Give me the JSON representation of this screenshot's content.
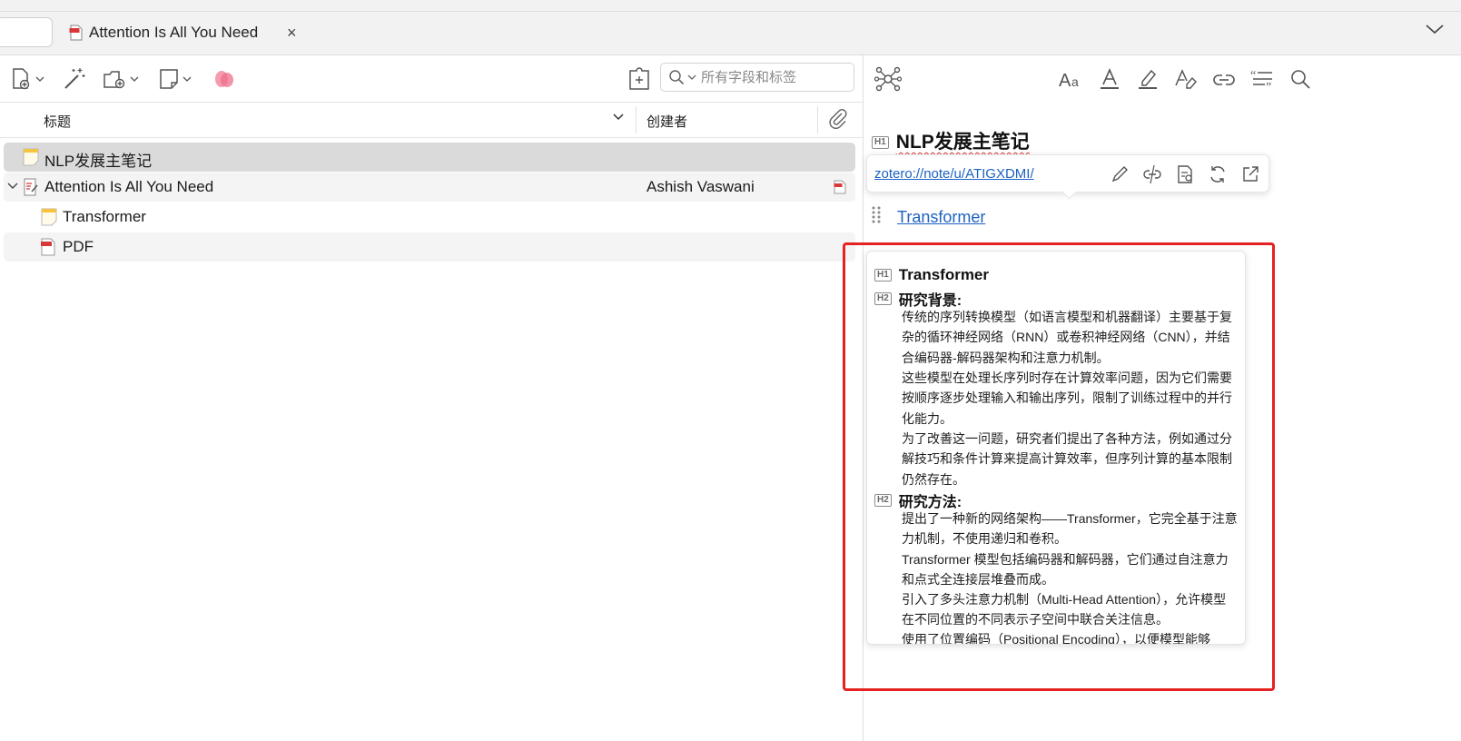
{
  "tabs": {
    "active_tab_title": "Attention Is All You Need",
    "close_symbol": "×"
  },
  "toolbar": {
    "search_placeholder": "所有字段和标签"
  },
  "items_table": {
    "columns": {
      "title": "标题",
      "creator": "创建者"
    },
    "rows": [
      {
        "title": "NLP发展主笔记",
        "creator": "",
        "icon": "note-icon",
        "selected": true
      },
      {
        "title": "Attention Is All You Need",
        "creator": "Ashish Vaswani",
        "icon": "journal-article-icon",
        "expanded": true,
        "has_pdf": true
      },
      {
        "title": "Transformer",
        "creator": "",
        "icon": "note-icon",
        "child": true
      },
      {
        "title": "PDF",
        "creator": "",
        "icon": "pdf-icon",
        "child": true
      }
    ]
  },
  "note_editor": {
    "heading_badge": "H1",
    "h2_badge": "H2",
    "title": "NLP发展主笔记",
    "link_popup": {
      "url": "zotero://note/u/ATIGXDMI/"
    },
    "link_text": "Transformer",
    "preview": {
      "title": "Transformer",
      "section1_heading": "研究背景:",
      "section1_paragraphs": [
        "传统的序列转换模型（如语言模型和机器翻译）主要基于复杂的循环神经网络（RNN）或卷积神经网络（CNN），并结合编码器-解码器架构和注意力机制。",
        "这些模型在处理长序列时存在计算效率问题，因为它们需要按顺序逐步处理输入和输出序列，限制了训练过程中的并行化能力。",
        "为了改善这一问题，研究者们提出了各种方法，例如通过分解技巧和条件计算来提高计算效率，但序列计算的基本限制仍然存在。"
      ],
      "section2_heading": "研究方法:",
      "section2_paragraphs": [
        "提出了一种新的网络架构——Transformer，它完全基于注意力机制，不使用递归和卷积。",
        "Transformer 模型包括编码器和解码器，它们通过自注意力和点式全连接层堆叠而成。",
        "引入了多头注意力机制（Multi-Head Attention），允许模型在不同位置的不同表示子空间中联合关注信息。",
        "使用了位置编码（Positional Encoding），以便模型能够"
      ]
    }
  },
  "colors": {
    "highlight_box": "#e52121",
    "link": "#1d62c4",
    "selected_row": "#dadada",
    "note_icon": "#f5c542",
    "pdf_icon": "#d9383a"
  }
}
